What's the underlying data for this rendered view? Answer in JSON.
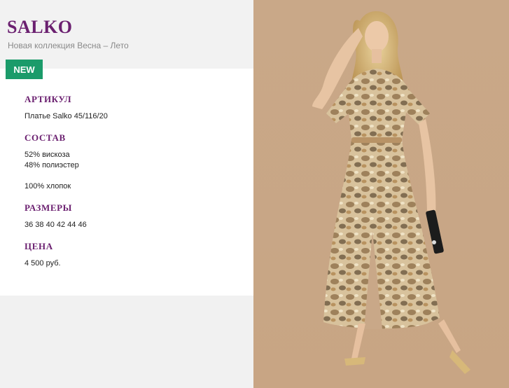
{
  "brand": {
    "name": "SALKO",
    "subtitle": "Новая коллекция Весна – Лето"
  },
  "badge": {
    "label": "NEW",
    "color": "#1b9b6a"
  },
  "accent_color": "#6b2070",
  "specs": {
    "article": {
      "heading": "АРТИКУЛ",
      "value": "Платье Salko 45/116/20"
    },
    "composition": {
      "heading": "СОСТАВ",
      "line1": "52% вискоза",
      "line2": "48% полиэстер",
      "line3": "100% хлопок"
    },
    "sizes": {
      "heading": "РАЗМЕРЫ",
      "value": "36 38 40 42 44 46"
    },
    "price": {
      "heading": "ЦЕНА",
      "value": "4 500 руб."
    }
  }
}
